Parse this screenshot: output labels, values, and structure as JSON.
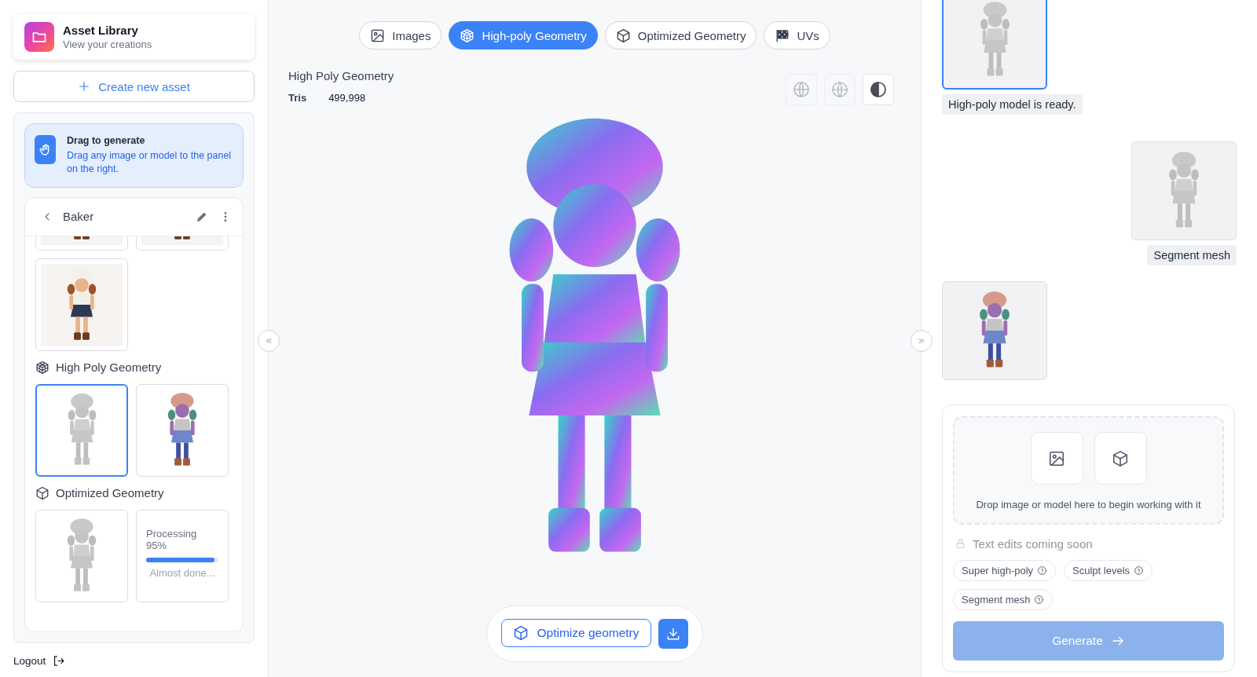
{
  "sidebar": {
    "header": {
      "title": "Asset Library",
      "subtitle": "View your creations"
    },
    "create_button": "Create new asset",
    "hint": {
      "title": "Drag to generate",
      "text": "Drag any image or model to the panel on the right."
    },
    "asset": {
      "name": "Baker"
    },
    "sections": [
      {
        "kind": "images",
        "items": [
          {
            "kind": "image",
            "selected": false
          },
          {
            "kind": "image",
            "selected": false
          },
          {
            "kind": "image",
            "selected": false
          }
        ]
      },
      {
        "kind": "high-poly",
        "title": "High Poly Geometry",
        "items": [
          {
            "kind": "gray-model",
            "selected": true
          },
          {
            "kind": "segmented-model",
            "selected": false
          }
        ]
      },
      {
        "kind": "optimized",
        "title": "Optimized Geometry",
        "items": [
          {
            "kind": "gray-model",
            "selected": false
          },
          {
            "kind": "processing",
            "selected": false,
            "label": "Processing",
            "percent": "95%",
            "level": 0.95,
            "note": "Almost done..."
          }
        ]
      }
    ],
    "logout": "Logout"
  },
  "viewer": {
    "tabs": [
      {
        "kind": "image",
        "label": "Images",
        "selected": false
      },
      {
        "kind": "wireframe",
        "label": "High-poly Geometry",
        "selected": true
      },
      {
        "kind": "cube",
        "label": "Optimized Geometry",
        "selected": false
      },
      {
        "kind": "checker",
        "label": "UVs",
        "selected": false
      }
    ],
    "title": "High Poly Geometry",
    "stats": [
      {
        "label": "Tris",
        "value": "499,998"
      }
    ],
    "view_modes": [
      {
        "kind": "globe",
        "selected": false
      },
      {
        "kind": "dashed-globe",
        "selected": false
      },
      {
        "kind": "contrast",
        "selected": true
      }
    ],
    "optimize_button": "Optimize geometry"
  },
  "chat": {
    "messages": [
      {
        "kind": "received-gray-model",
        "selected": true
      },
      {
        "kind": "received-text",
        "text": "High-poly model is ready."
      },
      {
        "kind": "sent-gray-model",
        "selected": false
      },
      {
        "kind": "sent-text",
        "text": "Segment mesh"
      },
      {
        "kind": "received-segmented-model",
        "selected": false
      }
    ],
    "composer": {
      "drop_text": "Drop image or model here to begin working with it",
      "input": {
        "placeholder": "Text edits coming soon",
        "disabled": true
      },
      "options": [
        {
          "label": "Super high-poly"
        },
        {
          "label": "Sculpt levels"
        },
        {
          "label": "Segment mesh"
        }
      ],
      "generate": {
        "label": "Generate",
        "disabled": true
      }
    }
  }
}
